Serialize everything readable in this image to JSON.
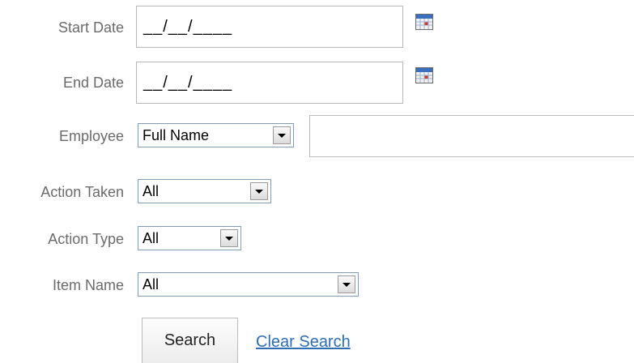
{
  "labels": {
    "start_date": "Start Date",
    "end_date": "End Date",
    "employee": "Employee",
    "action_taken": "Action Taken",
    "action_type": "Action Type",
    "item_name": "Item Name"
  },
  "fields": {
    "start_date_value": "__/__/____",
    "end_date_value": "__/__/____",
    "employee_mode": "Full Name",
    "employee_value": "",
    "action_taken": "All",
    "action_type": "All",
    "item_name": "All"
  },
  "buttons": {
    "search": "Search",
    "clear_search": "Clear Search"
  },
  "icons": {
    "calendar": "calendar-icon"
  },
  "colors": {
    "label": "#6b6b6b",
    "link": "#2f6db5",
    "calendar_header": "#3a6fc0",
    "calendar_accent": "#d23a2a"
  }
}
